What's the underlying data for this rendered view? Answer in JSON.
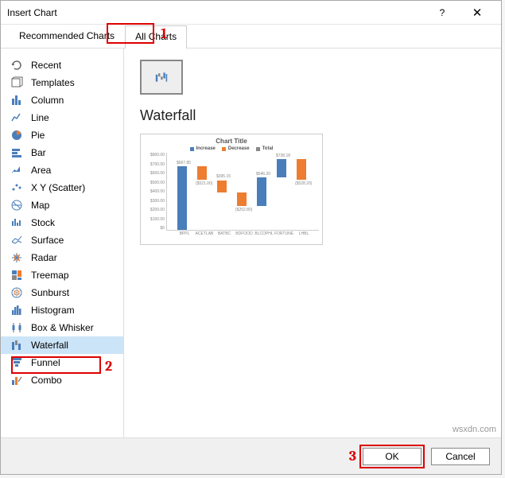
{
  "dialog": {
    "title": "Insert Chart",
    "help": "?",
    "close": "✕"
  },
  "tabs": {
    "recommended": "Recommended Charts",
    "all": "All Charts"
  },
  "sidebar": [
    {
      "label": "Recent"
    },
    {
      "label": "Templates"
    },
    {
      "label": "Column"
    },
    {
      "label": "Line"
    },
    {
      "label": "Pie"
    },
    {
      "label": "Bar"
    },
    {
      "label": "Area"
    },
    {
      "label": "X Y (Scatter)"
    },
    {
      "label": "Map"
    },
    {
      "label": "Stock"
    },
    {
      "label": "Surface"
    },
    {
      "label": "Radar"
    },
    {
      "label": "Treemap"
    },
    {
      "label": "Sunburst"
    },
    {
      "label": "Histogram"
    },
    {
      "label": "Box & Whisker"
    },
    {
      "label": "Waterfall"
    },
    {
      "label": "Funnel"
    },
    {
      "label": "Combo"
    }
  ],
  "main": {
    "chart_name": "Waterfall",
    "preview_title": "Chart Title",
    "legend": {
      "inc": "Increase",
      "dec": "Decrease",
      "tot": "Total"
    }
  },
  "footer": {
    "ok": "OK",
    "cancel": "Cancel"
  },
  "annotations": {
    "a1": "1",
    "a2": "2",
    "a3": "3"
  },
  "watermark": "wsxdn.com",
  "chart_data": {
    "type": "bar",
    "title": "Chart Title",
    "series_legend": [
      "Increase",
      "Decrease",
      "Total"
    ],
    "ylim": [
      0,
      800
    ],
    "yticks": [
      "$800.00",
      "$700.00",
      "$600.00",
      "$500.00",
      "$400.00",
      "$300.00",
      "$200.00",
      "$100.00",
      "$0"
    ],
    "categories": [
      "BPPL",
      "ACETLAB",
      "BATBC",
      "BDFOOD",
      "BLCOPHL",
      "FORTUNE",
      "LHBL"
    ],
    "bars": [
      {
        "top": 667.85,
        "bottom": 0,
        "color": "#4a7ebb",
        "label": "$667.85"
      },
      {
        "top": 667.85,
        "bottom": 521.0,
        "color": "#ed7d31",
        "label": "($521.00)"
      },
      {
        "top": 521.0,
        "bottom": 395.15,
        "color": "#ed7d31",
        "label": "$395.15"
      },
      {
        "top": 395.15,
        "bottom": 252.8,
        "color": "#ed7d31",
        "label": "($252.80)"
      },
      {
        "top": 546.2,
        "bottom": 252.8,
        "color": "#4a7ebb",
        "label": "$546.20"
      },
      {
        "top": 738.18,
        "bottom": 546.2,
        "color": "#4a7ebb",
        "label": "$738.18"
      },
      {
        "top": 738.18,
        "bottom": 528.2,
        "color": "#ed7d31",
        "label": "($528.20)"
      }
    ]
  }
}
